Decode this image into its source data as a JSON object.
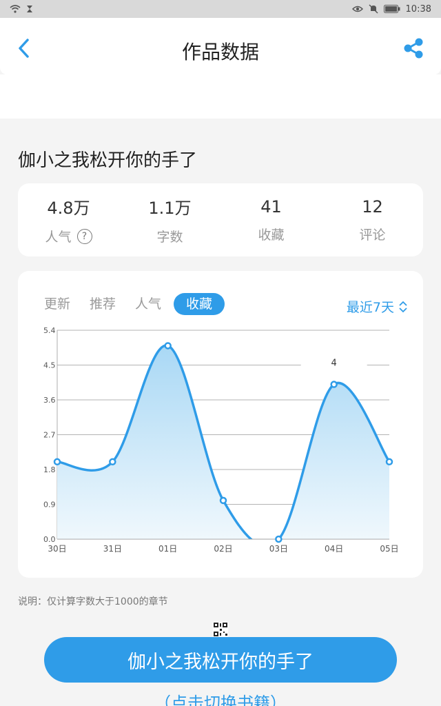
{
  "status_bar": {
    "time": "10:38"
  },
  "header": {
    "title": "作品数据"
  },
  "work": {
    "title": "伽小之我松开你的手了"
  },
  "stats": [
    {
      "value": "4.8万",
      "label": "人气"
    },
    {
      "value": "1.1万",
      "label": "字数"
    },
    {
      "value": "41",
      "label": "收藏"
    },
    {
      "value": "12",
      "label": "评论"
    }
  ],
  "tabs": [
    {
      "label": "更新",
      "active": false
    },
    {
      "label": "推荐",
      "active": false
    },
    {
      "label": "人气",
      "active": false
    },
    {
      "label": "收藏",
      "active": true
    }
  ],
  "range": {
    "label": "最近7天"
  },
  "chart_data": {
    "type": "area",
    "categories": [
      "30日",
      "31日",
      "01日",
      "02日",
      "03日",
      "04日",
      "05日"
    ],
    "values": [
      2,
      2,
      5,
      1,
      0,
      4,
      2
    ],
    "yticks": [
      "5.4",
      "4.5",
      "3.6",
      "2.7",
      "1.8",
      "0.9",
      "0.0"
    ],
    "ylim": [
      0,
      5.4
    ],
    "annotation": {
      "category": "04日",
      "text": "4"
    },
    "colors": {
      "line": "#2f9ce8",
      "fill_top": "#a9d8f5",
      "fill_bottom": "#f2f9fd"
    }
  },
  "note": "说明：仅计算字数大于1000的章节",
  "button": {
    "label": "伽小之我松开你的手了"
  },
  "switch_link": "（点击切换书籍）",
  "colors": {
    "accent": "#2f9ce8",
    "background": "#f4f4f4"
  }
}
